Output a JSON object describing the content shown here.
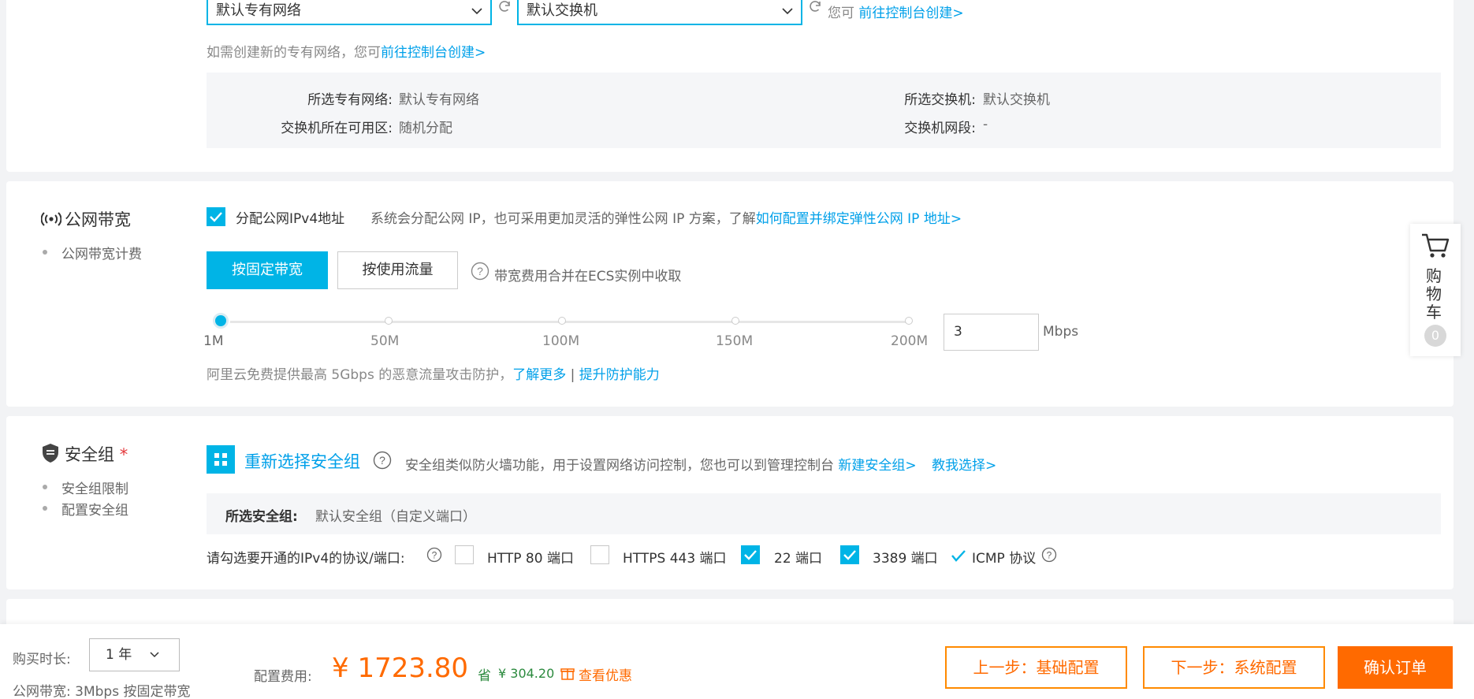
{
  "network": {
    "vpc_select": "默认专有网络",
    "vswitch_select": "默认交换机",
    "hint_prefix": "您可",
    "hint_link": "前往控制台创建>",
    "create_hint_text": "如需创建新的专有网络，您可",
    "create_hint_link": "前往控制台创建>",
    "info": {
      "vpc_label": "所选专有网络:",
      "vpc_value": "默认专有网络",
      "vswitch_label": "所选交换机:",
      "vswitch_value": "默认交换机",
      "zone_label": "交换机所在可用区:",
      "zone_value": "随机分配",
      "cidr_label": "交换机网段:",
      "cidr_value": "-"
    }
  },
  "bandwidth": {
    "title": "公网带宽",
    "side_item": "公网带宽计费",
    "assign_label": "分配公网IPv4地址",
    "assign_checked": true,
    "assign_desc": "系统会分配公网 IP，也可采用更加灵活的弹性公网 IP 方案，了解",
    "assign_link": "如何配置并绑定弹性公网 IP 地址>",
    "btn_fixed": "按固定带宽",
    "btn_traffic": "按使用流量",
    "fee_note": "带宽费用合并在ECS实例中收取",
    "slider_ticks": [
      "1M",
      "50M",
      "100M",
      "150M",
      "200M"
    ],
    "slider_value": 3,
    "input_value": "3",
    "unit": "Mbps",
    "ddos_text": "阿里云免费提供最高 5Gbps 的恶意流量攻击防护，",
    "ddos_link1": "了解更多",
    "ddos_sep": "|",
    "ddos_link2": "提升防护能力"
  },
  "security": {
    "title": "安全组",
    "required_mark": "*",
    "side_items": [
      "安全组限制",
      "配置安全组"
    ],
    "reselect": "重新选择安全组",
    "desc": "安全组类似防火墙功能，用于设置网络访问控制，您也可以到管理控制台",
    "link_new": "新建安全组>",
    "link_teach": "教我选择>",
    "selected_label": "所选安全组:",
    "selected_value": "默认安全组（自定义端口）",
    "ports_label": "请勾选要开通的IPv4的协议/端口:",
    "ports": [
      {
        "label": "HTTP 80 端口",
        "checked": false
      },
      {
        "label": "HTTPS 443 端口",
        "checked": false
      },
      {
        "label": "22 端口",
        "checked": true
      },
      {
        "label": "3389 端口",
        "checked": true
      }
    ],
    "icmp": "ICMP 协议"
  },
  "cart": {
    "label_chars": [
      "购",
      "物",
      "车"
    ],
    "count": "0"
  },
  "footer": {
    "duration_label": "购买时长:",
    "duration_value": "1 年",
    "bandwidth_summary": "公网带宽:  3Mbps 按固定带宽",
    "fee_label": "配置费用:",
    "price": "¥ 1723.80",
    "save_label": "省",
    "save_value": "¥ 304.20",
    "discount_link": "查看优惠",
    "prev_btn": "上一步：基础配置",
    "next_btn": "下一步：系统配置",
    "confirm_btn": "确认订单"
  },
  "colors": {
    "accent": "#00b4e6",
    "link": "#00a0e9",
    "orange": "#ff6a00",
    "green": "#2b8a3e"
  }
}
